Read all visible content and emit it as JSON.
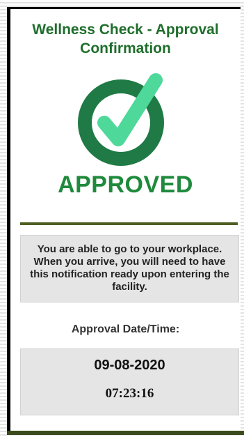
{
  "header": {
    "title_line1": "Wellness Check - Approval",
    "title_line2": "Confirmation"
  },
  "status": {
    "icon": "check-circle-icon",
    "label": "APPROVED",
    "ring_color": "#1f7a45",
    "check_color": "#4ed89a",
    "label_color": "#1f8a3c"
  },
  "notice": {
    "text": "You are able to go to your workplace. When you arrive, you will need to have this notification ready upon entering the facility."
  },
  "approval": {
    "label": "Approval Date/Time:",
    "date": "09-08-2020",
    "time": "07:23:16"
  }
}
